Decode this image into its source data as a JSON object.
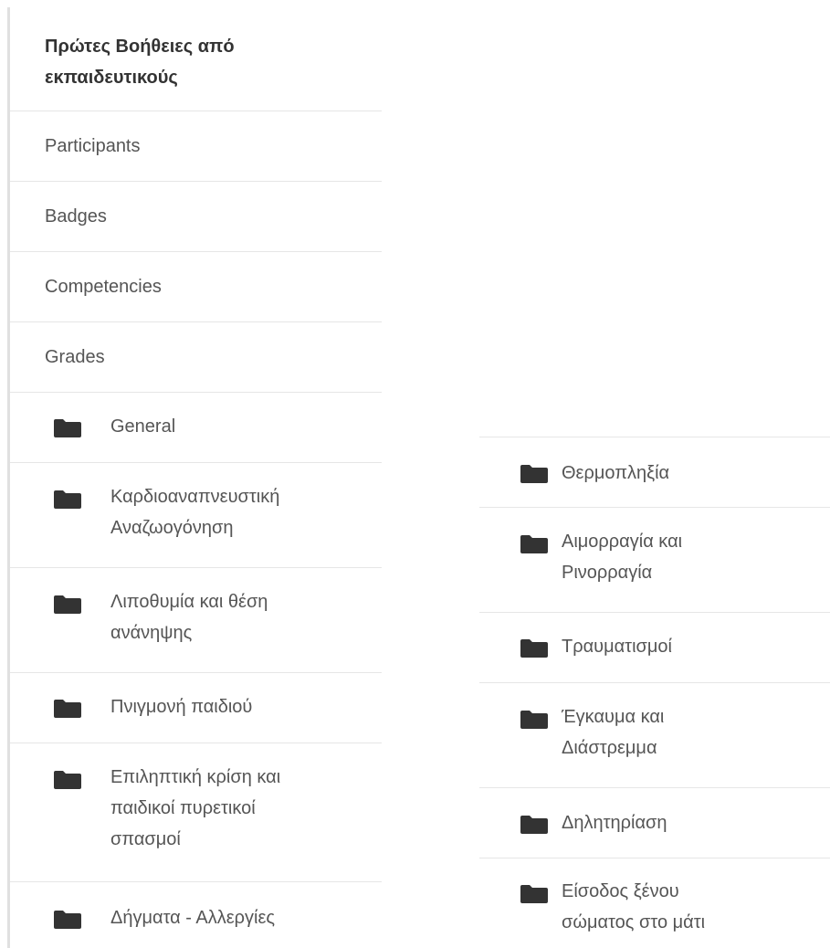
{
  "course_nav": {
    "title_line1": "Πρώτες Βοήθειες από",
    "title_line2": "εκπαιδευτικούς",
    "links": [
      {
        "label": "Participants"
      },
      {
        "label": "Badges"
      },
      {
        "label": "Competencies"
      },
      {
        "label": "Grades"
      }
    ],
    "sections": [
      {
        "lines": [
          "General"
        ]
      },
      {
        "lines": [
          "Καρδιοαναπνευστική",
          "Αναζωογόνηση"
        ]
      },
      {
        "lines": [
          "Λιποθυμία και θέση",
          "ανάνηψης"
        ]
      },
      {
        "lines": [
          "Πνιγμονή παιδιού"
        ]
      },
      {
        "lines": [
          "Επιληπτική κρίση και",
          "παιδικοί πυρετικοί",
          "σπασμοί"
        ]
      },
      {
        "lines": [
          "Δήγματα - Αλλεργίες"
        ]
      }
    ]
  },
  "more_sections": [
    {
      "lines": [
        "Θερμοπληξία"
      ]
    },
    {
      "lines": [
        "Αιμορραγία και",
        "Ρινορραγία"
      ]
    },
    {
      "lines": [
        "Τραυματισμοί"
      ]
    },
    {
      "lines": [
        "Έγκαυμα και",
        "Διάστρεμμα"
      ]
    },
    {
      "lines": [
        "Δηλητηρίαση"
      ]
    },
    {
      "lines": [
        "Είσοδος ξένου",
        "σώματος στο μάτι"
      ]
    }
  ],
  "icons": {
    "section": "folder-icon"
  },
  "colors": {
    "text": "#555555",
    "title": "#333333",
    "icon": "#333333",
    "divider": "#e6e6e6"
  }
}
